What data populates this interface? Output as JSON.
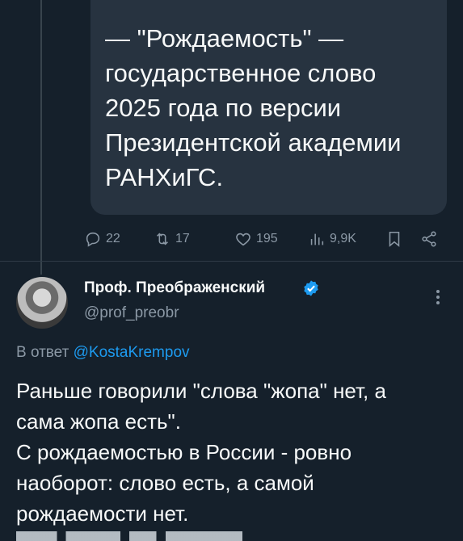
{
  "quoted_tweet": {
    "text": "— \"Рождаемость\" —\nгосударственное слово\n2025 года по версии\nПрезидентской академии\nРАНХиГС."
  },
  "actions": {
    "replies": "22",
    "retweets": "17",
    "likes": "195",
    "views": "9,9K"
  },
  "reply": {
    "author_name": "Проф. Преображенский",
    "author_handle": "@prof_preobr",
    "reply_to_prefix": "В ответ",
    "reply_to_handle": "@KostaKrempov",
    "text": "Раньше говорили \"слова \"жопа\" нет, а\nсама жопа есть\".\nС рождаемостью в России - ровно\nнаоборот: слово есть, а самой\nрождаемости нет."
  },
  "colors": {
    "background": "#15202b",
    "link": "#1d9bf0",
    "verified": "#1d9bf0",
    "secondary_text": "#8b98a5"
  }
}
